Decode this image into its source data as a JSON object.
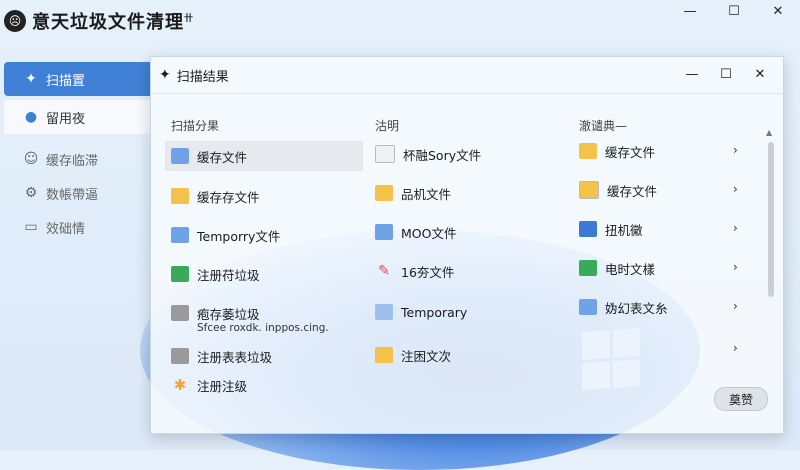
{
  "app": {
    "title": "意天垃圾文件清理",
    "title_suffix": "卄"
  },
  "window_controls": {
    "minimize": "—",
    "maximize": "☐",
    "close": "✕"
  },
  "sidebar": {
    "items": [
      {
        "label": "扫描置",
        "icon": "pin-icon"
      },
      {
        "label": "留用夜",
        "icon": "mic-icon"
      },
      {
        "label": "缓存临滞",
        "icon": "user-icon"
      },
      {
        "label": "数帳帶逼",
        "icon": "gear-icon"
      },
      {
        "label": "效础情",
        "icon": "document-icon"
      }
    ]
  },
  "results": {
    "title": "扫描结果",
    "controls": {
      "minimize": "—",
      "maximize": "☐",
      "close": "✕"
    },
    "col1": {
      "header": "扫描分果",
      "items": [
        "缓存文件",
        "缓存存文件",
        "Temporry文件",
        "注册苻垃圾",
        "疱存萎垃圾",
        "注册表表垃圾",
        "注册注级"
      ],
      "sub": "Sfcee roxdk. inppos.cing."
    },
    "col2": {
      "header": "沽明",
      "items": [
        "杯融Sory文件",
        "品机文件",
        "MOO文件",
        "16夯文件",
        "Temporary",
        "注困文次"
      ]
    },
    "col3": {
      "header": "澈谴典—",
      "items": [
        "缓存文件",
        "缓存文件",
        "扭机黴",
        "电时文樣",
        "妫幻表文糸"
      ]
    },
    "button": "奠赞"
  },
  "colors": {
    "accent": "#3f7fd6",
    "folder": "#f3c24b"
  }
}
